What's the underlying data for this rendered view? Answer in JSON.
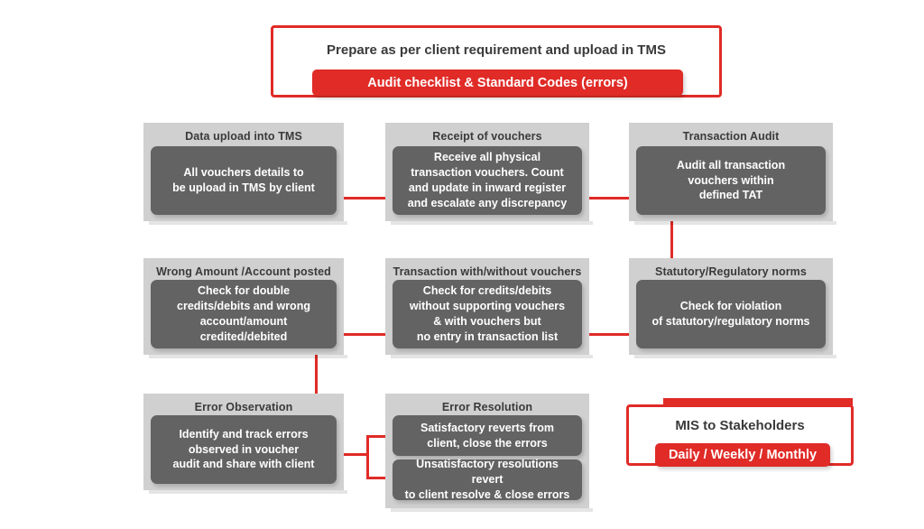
{
  "diagram": {
    "title_banner": {
      "heading": "Prepare as per client requirement and upload in TMS",
      "band_label": "Audit checklist & Standard Codes (errors)"
    },
    "process_boxes": [
      {
        "id": "data-upload-into-tms",
        "title": "Data upload into TMS",
        "body": "All vouchers details to\nbe upload in TMS by client"
      },
      {
        "id": "receipt-of-vouchers",
        "title": "Receipt of vouchers",
        "body": "Receive all physical\ntransaction vouchers. Count\nand update in inward register\nand escalate any discrepancy"
      },
      {
        "id": "transaction-audit",
        "title": "Transaction Audit",
        "body": "Audit all transaction\nvouchers within\ndefined TAT"
      },
      {
        "id": "wrong-amount-account-posted",
        "title": "Wrong Amount /Account posted",
        "body": "Check for double\ncredits/debits and wrong\naccount/amount\ncredited/debited"
      },
      {
        "id": "transaction-with-without-vouchers",
        "title": "Transaction with/without vouchers",
        "body": "Check for credits/debits\nwithout supporting vouchers\n& with vouchers but\nno entry in transaction list"
      },
      {
        "id": "statutory-regulatory-norms",
        "title": "Statutory/Regulatory norms",
        "body": "Check for violation\nof statutory/regulatory norms"
      },
      {
        "id": "error-observation",
        "title": "Error Observation",
        "body": "Identify and track errors\nobserved in voucher\naudit and share with client"
      }
    ],
    "error_resolution": {
      "title": "Error Resolution",
      "body_1": "Satisfactory reverts from\nclient, close the errors",
      "body_2": "Unsatisfactory resolutions revert\nto client resolve & close errors"
    },
    "mis_banner": {
      "heading": "MIS to Stakeholders",
      "band_label": "Daily / Weekly / Monthly"
    },
    "colors": {
      "accent_red": "#e02b27",
      "card_background": "#d0d0d0",
      "card_body": "#636363",
      "text_dark": "#3a3a3a",
      "text_light": "#ffffff",
      "page_background": "#ffffff"
    }
  }
}
